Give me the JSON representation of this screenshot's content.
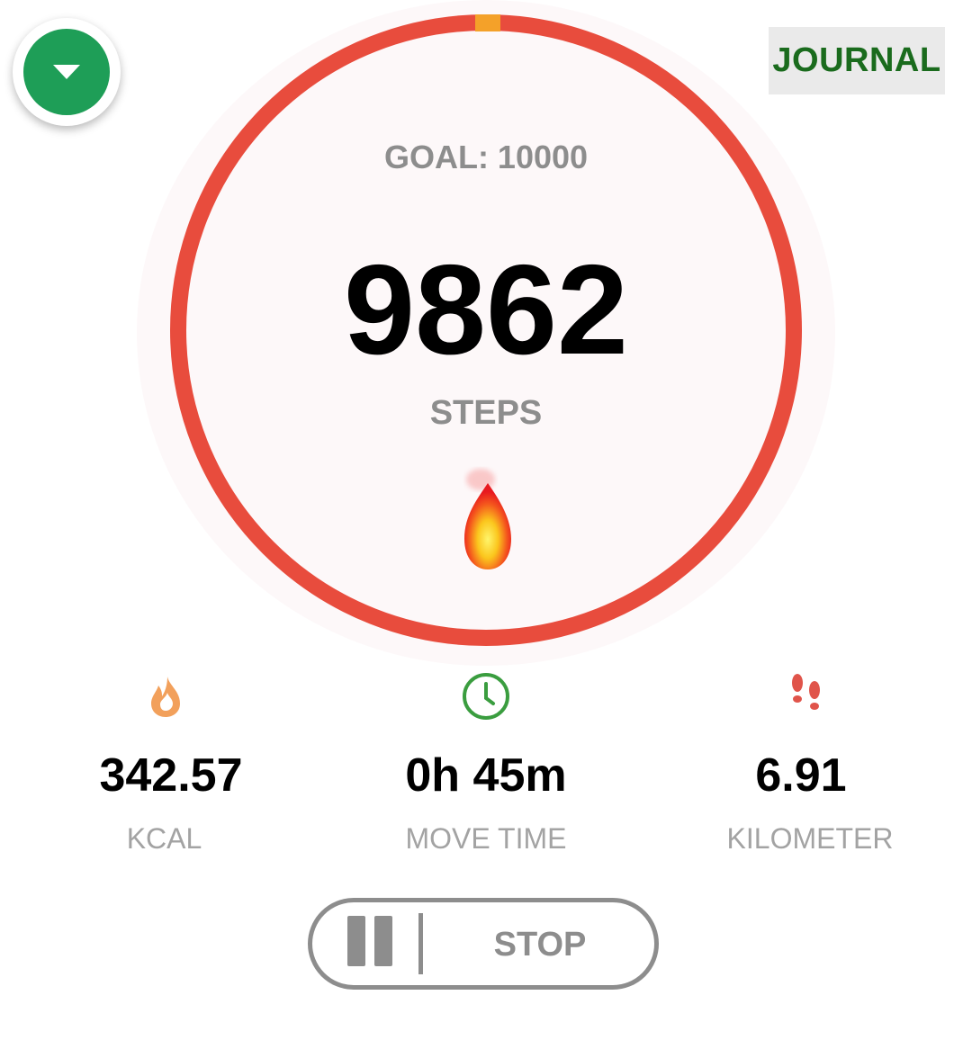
{
  "header": {
    "journal_label": "JOURNAL",
    "dropdown_icon": "chevron-down-icon"
  },
  "progress": {
    "goal_label": "GOAL: 10000",
    "steps_value": "9862",
    "steps_label": "STEPS",
    "goal": 10000,
    "steps": 9862,
    "ring_color": "#e84c3d",
    "marker_color": "#f4a129",
    "center_icon": "fire-icon"
  },
  "stats": {
    "kcal": {
      "value": "342.57",
      "label": "KCAL",
      "icon": "flame-icon",
      "icon_color": "#f2a05b"
    },
    "move_time": {
      "value": "0h 45m",
      "label": "MOVE TIME",
      "icon": "clock-icon",
      "icon_color": "#3a9d3f"
    },
    "distance": {
      "value": "6.91",
      "label": "KILOMETER",
      "icon": "footprints-icon",
      "icon_color": "#e0544a"
    }
  },
  "controls": {
    "pause_icon": "pause-icon",
    "stop_label": "STOP"
  }
}
